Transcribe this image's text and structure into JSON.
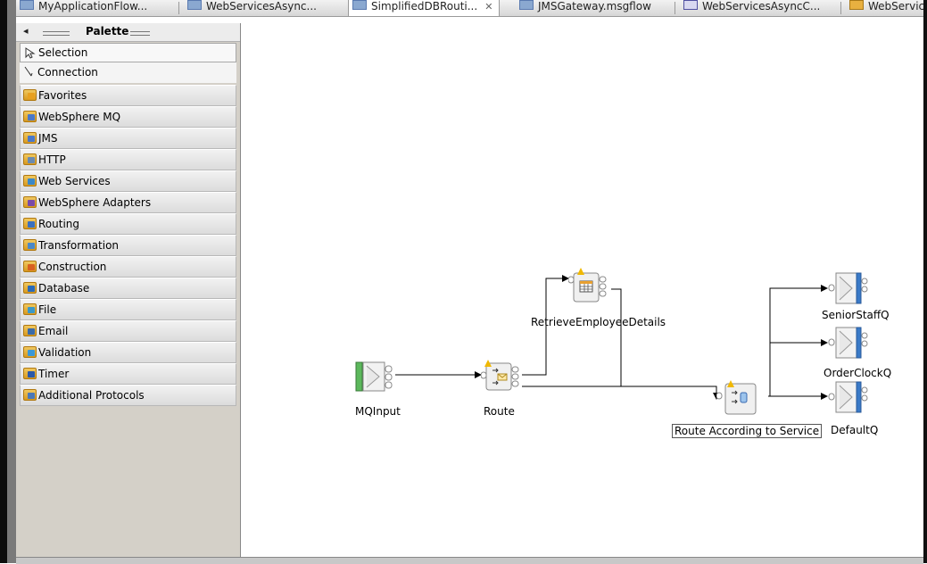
{
  "tabs": [
    {
      "label": "MyApplicationFlow...",
      "icon": "flow-icon"
    },
    {
      "label": "WebServicesAsync...",
      "icon": "flow-icon"
    },
    {
      "label": "SimplifiedDBRouti...",
      "icon": "flow-icon",
      "active": true,
      "close": "✕"
    },
    {
      "label": "JMSGateway.msgflow",
      "icon": "flow-icon"
    },
    {
      "label": "WebServicesAsyncC...",
      "icon": "binary-icon"
    },
    {
      "label": "WebServic",
      "icon": "warning-icon"
    }
  ],
  "palette": {
    "title": "Palette",
    "collapse": "◂",
    "tools": [
      {
        "label": "Selection",
        "icon": "arrow-pointer-icon"
      },
      {
        "label": "Connection",
        "icon": "connection-icon"
      }
    ],
    "drawers": [
      {
        "label": "Favorites",
        "color": "#e8a020"
      },
      {
        "label": "WebSphere MQ",
        "color": "#4a78c8"
      },
      {
        "label": "JMS",
        "color": "#4a78c8"
      },
      {
        "label": "HTTP",
        "color": "#6a8ab0"
      },
      {
        "label": "Web Services",
        "color": "#3a88c8"
      },
      {
        "label": "WebSphere Adapters",
        "color": "#7a4aa8"
      },
      {
        "label": "Routing",
        "color": "#3a70c0"
      },
      {
        "label": "Transformation",
        "color": "#4a88c8"
      },
      {
        "label": "Construction",
        "color": "#d86020"
      },
      {
        "label": "Database",
        "color": "#2a6ab8"
      },
      {
        "label": "File",
        "color": "#3a98c8"
      },
      {
        "label": "Email",
        "color": "#3a6aa8"
      },
      {
        "label": "Validation",
        "color": "#3a98d8"
      },
      {
        "label": "Timer",
        "color": "#2a58a8"
      },
      {
        "label": "Additional Protocols",
        "color": "#4a78b8"
      }
    ]
  },
  "flow": {
    "nodes": {
      "mqinput": {
        "label": "MQInput"
      },
      "route": {
        "label": "Route"
      },
      "retrieve": {
        "label": "RetrieveEmployeeDetails"
      },
      "route_service": {
        "label": "Route According to Service"
      },
      "senior": {
        "label": "SeniorStaffQ"
      },
      "orderclock": {
        "label": "OrderClockQ"
      },
      "default": {
        "label": "DefaultQ"
      }
    }
  },
  "colors": {
    "accent": "#3a7ac8",
    "input_node": "#5cb85c",
    "warning": "#f0b800"
  }
}
